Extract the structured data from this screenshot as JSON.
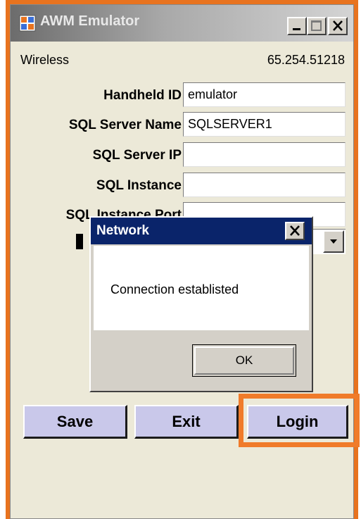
{
  "window": {
    "title": "AWM Emulator",
    "icon": "app-window-icon"
  },
  "status": {
    "mode": "Wireless",
    "version": "65.254.51218"
  },
  "form": {
    "handheld_id": {
      "label": "Handheld ID",
      "value": "emulator"
    },
    "sql_server_name": {
      "label": "SQL Server Name",
      "value": "SQLSERVER1"
    },
    "sql_server_ip": {
      "label": "SQL Server IP",
      "value": ""
    },
    "sql_instance": {
      "label": "SQL Instance",
      "value": ""
    },
    "sql_instance_port": {
      "label": "SQL Instance Port",
      "value": ""
    }
  },
  "buttons": {
    "save": "Save",
    "exit": "Exit",
    "login": "Login"
  },
  "dialog": {
    "title": "Network",
    "message": "Connection establisted",
    "ok": "OK"
  },
  "colors": {
    "highlight": "#f07b2a",
    "dialog_title": "#0a246a",
    "action_button": "#c9c8ea"
  }
}
